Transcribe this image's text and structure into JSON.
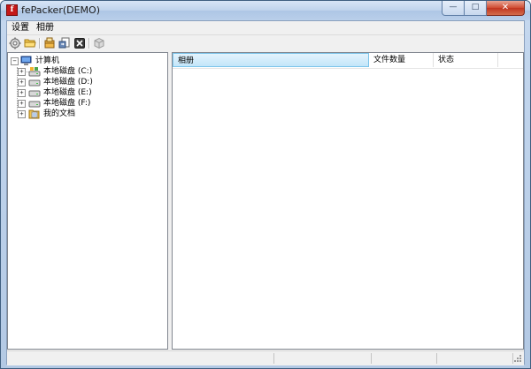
{
  "window": {
    "title": "fePacker(DEMO)",
    "app_icon_glyph": "f",
    "controls": {
      "minimize": "—",
      "maximize": "□",
      "close": "✕"
    }
  },
  "menu": {
    "items": [
      {
        "label": "设置"
      },
      {
        "label": "相册"
      }
    ]
  },
  "toolbar": {
    "icons": [
      "settings-gear-icon",
      "open-folder-icon",
      "package-icon",
      "export-icon",
      "delete-icon",
      "box-icon"
    ]
  },
  "tree": {
    "root": {
      "label": "计算机",
      "expander": "−",
      "icon": "computer-icon"
    },
    "children": [
      {
        "label": "本地磁盘 (C:)",
        "expander": "+",
        "icon": "system-drive-icon"
      },
      {
        "label": "本地磁盘 (D:)",
        "expander": "+",
        "icon": "drive-icon"
      },
      {
        "label": "本地磁盘 (E:)",
        "expander": "+",
        "icon": "drive-icon"
      },
      {
        "label": "本地磁盘 (F:)",
        "expander": "+",
        "icon": "drive-icon"
      },
      {
        "label": "我的文档",
        "expander": "+",
        "icon": "documents-folder-icon"
      }
    ]
  },
  "list": {
    "columns": [
      {
        "label": "相册"
      },
      {
        "label": "文件数量"
      },
      {
        "label": "状态"
      }
    ],
    "rows": []
  },
  "status": {
    "cells": [
      "",
      "",
      "",
      ""
    ]
  },
  "colors": {
    "title_gradient_top": "#d7e5f6",
    "close_button": "#c13520",
    "selected_header": "#c3e6f9"
  }
}
